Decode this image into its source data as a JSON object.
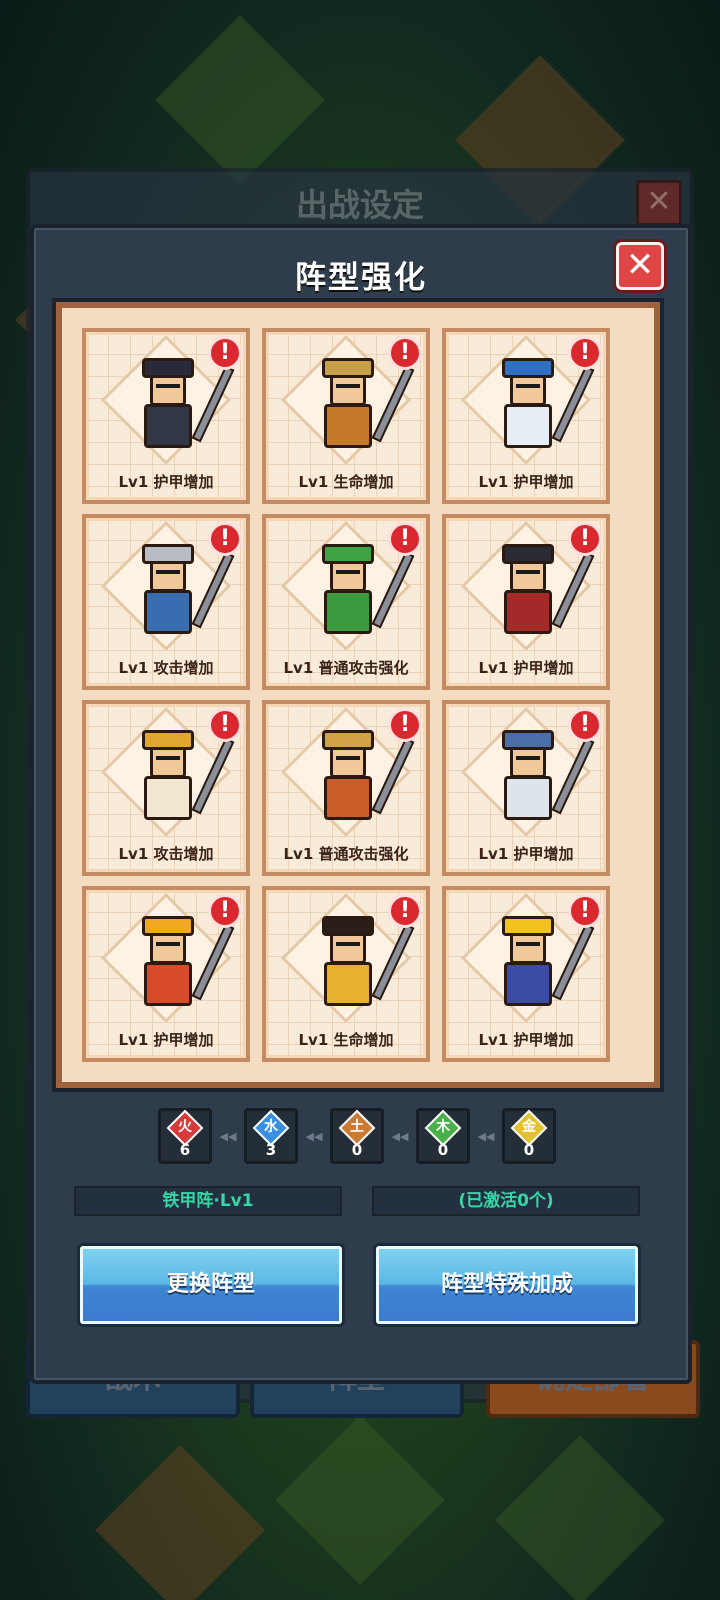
{
  "background": {
    "title": "出战设定",
    "buttons": [
      "战术",
      "阵型",
      "确定部署"
    ]
  },
  "modal": {
    "title": "阵型强化",
    "close_icon": "close-icon"
  },
  "cards": [
    {
      "label": "Lv1 护甲增加",
      "hat_color": "#2a2a3a",
      "body_color": "#333846"
    },
    {
      "label": "Lv1 生命增加",
      "hat_color": "#c9a04a",
      "body_color": "#c47a2a"
    },
    {
      "label": "Lv1 护甲增加",
      "hat_color": "#2f6fc4",
      "body_color": "#e6edf5"
    },
    {
      "label": "Lv1 攻击增加",
      "hat_color": "#b8bcc4",
      "body_color": "#3a6db0"
    },
    {
      "label": "Lv1 普通攻击强化",
      "hat_color": "#3fa343",
      "body_color": "#3c9b3f"
    },
    {
      "label": "Lv1 护甲增加",
      "hat_color": "#2b2b33",
      "body_color": "#a42a2a"
    },
    {
      "label": "Lv1 攻击增加",
      "hat_color": "#e0a630",
      "body_color": "#f2e7d0"
    },
    {
      "label": "Lv1 普通攻击强化",
      "hat_color": "#d1a247",
      "body_color": "#c95d2a"
    },
    {
      "label": "Lv1 护甲增加",
      "hat_color": "#4a6ea8",
      "body_color": "#dde3ea"
    },
    {
      "label": "Lv1 护甲增加",
      "hat_color": "#f0a820",
      "body_color": "#d74a2a"
    },
    {
      "label": "Lv1 生命增加",
      "hat_color": "#2b1e18",
      "body_color": "#e8b030"
    },
    {
      "label": "Lv1 护甲增加",
      "hat_color": "#f2c21e",
      "body_color": "#3c4ca6"
    }
  ],
  "elements": [
    {
      "glyph": "火",
      "count": "6",
      "color": "#d93a3a"
    },
    {
      "glyph": "水",
      "count": "3",
      "color": "#3a8fe0"
    },
    {
      "glyph": "土",
      "count": "0",
      "color": "#c97a35"
    },
    {
      "glyph": "木",
      "count": "0",
      "color": "#49b04a"
    },
    {
      "glyph": "金",
      "count": "0",
      "color": "#e3c232"
    }
  ],
  "formation_status": "铁甲阵·Lv1",
  "activation_status": "(已激活0个)",
  "buttons": {
    "change_formation": "更换阵型",
    "special_bonus": "阵型特殊加成"
  }
}
